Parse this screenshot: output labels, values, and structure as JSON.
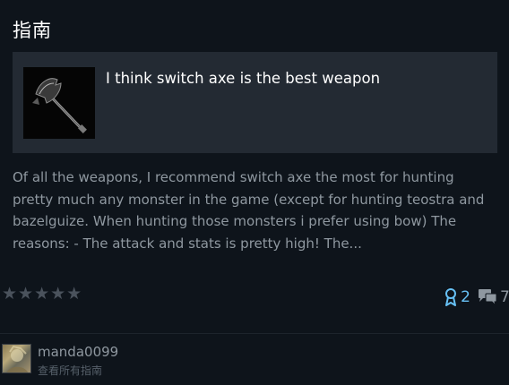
{
  "section": {
    "title": "指南"
  },
  "guide": {
    "title": "I think switch axe is the best weapon",
    "description": "Of all the weapons, I recommend switch axe the most for hunting pretty much any monster in the game (except for hunting teostra and bazelguize. When hunting those monsters i prefer using bow) The reasons: - The attack and stats is pretty high! The...",
    "rating_stars": "★★★★★",
    "rating_value": 0,
    "rating_max": 5,
    "awards": "2",
    "comments": "7"
  },
  "author": {
    "name": "manda0099",
    "view_all": "查看所有指南"
  },
  "icons": {
    "thumbnail": "switch-axe-icon",
    "award": "award-ribbon-icon",
    "comment": "comment-bubbles-icon"
  },
  "colors": {
    "background": "#0e141b",
    "card": "#232a33",
    "accent": "#67c1f5",
    "muted": "#8f98a0"
  }
}
